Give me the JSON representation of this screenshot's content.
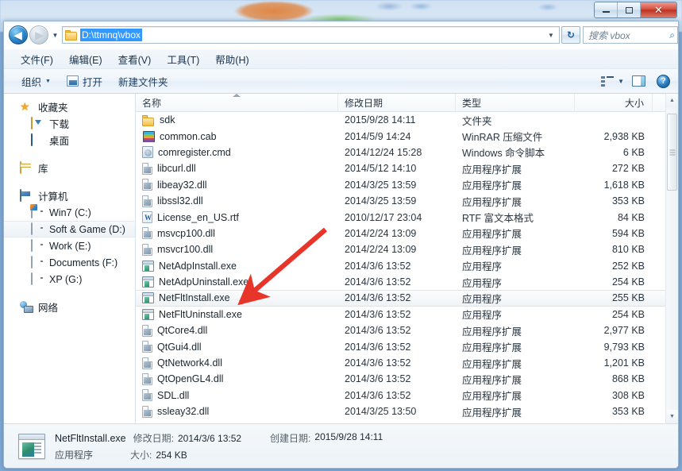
{
  "window": {
    "minimize_label": "–",
    "maximize_label": "□",
    "close_label": "✕"
  },
  "address": {
    "path": "D:\\ttmnq\\vbox",
    "back_glyph": "◀",
    "forward_glyph": "▶",
    "history_glyph": "▼",
    "dropdown_glyph": "▼",
    "refresh_glyph": "↻"
  },
  "search": {
    "placeholder": "搜索 vbox",
    "icon_glyph": "⌕"
  },
  "menu": {
    "items": [
      {
        "label": "文件(F)"
      },
      {
        "label": "编辑(E)"
      },
      {
        "label": "查看(V)"
      },
      {
        "label": "工具(T)"
      },
      {
        "label": "帮助(H)"
      }
    ]
  },
  "toolbar": {
    "organize_label": "组织",
    "organize_arrow": "▼",
    "open_label": "打开",
    "new_folder_label": "新建文件夹",
    "view_caret": "▼",
    "help_label": "?"
  },
  "sidebar": {
    "groups": [
      {
        "header": {
          "label": "收藏夹",
          "icon": "star-icon"
        },
        "items": [
          {
            "label": "下载",
            "icon": "downloads-icon"
          },
          {
            "label": "桌面",
            "icon": "desktop-icon"
          }
        ]
      },
      {
        "header": {
          "label": "库",
          "icon": "libraries-icon"
        },
        "items": []
      },
      {
        "header": {
          "label": "计算机",
          "icon": "computer-icon"
        },
        "items": [
          {
            "label": "Win7 (C:)",
            "icon": "system-drive-icon",
            "selected": false
          },
          {
            "label": "Soft & Game (D:)",
            "icon": "drive-icon",
            "selected": true
          },
          {
            "label": "Work (E:)",
            "icon": "drive-icon",
            "selected": false
          },
          {
            "label": "Documents (F:)",
            "icon": "drive-icon",
            "selected": false
          },
          {
            "label": "XP (G:)",
            "icon": "drive-icon",
            "selected": false
          }
        ]
      },
      {
        "header": {
          "label": "网络",
          "icon": "network-icon"
        },
        "items": []
      }
    ]
  },
  "filelist": {
    "columns": [
      {
        "label": "名称",
        "key": "name",
        "sorted": "asc"
      },
      {
        "label": "修改日期",
        "key": "date"
      },
      {
        "label": "类型",
        "key": "type"
      },
      {
        "label": "大小",
        "key": "size"
      }
    ],
    "rows": [
      {
        "name": "sdk",
        "date": "2015/9/28 14:11",
        "type": "文件夹",
        "size": "",
        "icon": "folder-icon",
        "selected": false
      },
      {
        "name": "common.cab",
        "date": "2014/5/9 14:24",
        "type": "WinRAR 压缩文件",
        "size": "2,938 KB",
        "icon": "winrar-archive-icon",
        "selected": false
      },
      {
        "name": "comregister.cmd",
        "date": "2014/12/24 15:28",
        "type": "Windows 命令脚本",
        "size": "6 KB",
        "icon": "cmd-script-icon",
        "selected": false
      },
      {
        "name": "libcurl.dll",
        "date": "2014/5/12 14:10",
        "type": "应用程序扩展",
        "size": "272 KB",
        "icon": "dll-icon",
        "selected": false
      },
      {
        "name": "libeay32.dll",
        "date": "2014/3/25 13:59",
        "type": "应用程序扩展",
        "size": "1,618 KB",
        "icon": "dll-icon",
        "selected": false
      },
      {
        "name": "libssl32.dll",
        "date": "2014/3/25 13:59",
        "type": "应用程序扩展",
        "size": "353 KB",
        "icon": "dll-icon",
        "selected": false
      },
      {
        "name": "License_en_US.rtf",
        "date": "2010/12/17 23:04",
        "type": "RTF 富文本格式",
        "size": "84 KB",
        "icon": "rtf-document-icon",
        "selected": false
      },
      {
        "name": "msvcp100.dll",
        "date": "2014/2/24 13:09",
        "type": "应用程序扩展",
        "size": "594 KB",
        "icon": "dll-icon",
        "selected": false
      },
      {
        "name": "msvcr100.dll",
        "date": "2014/2/24 13:09",
        "type": "应用程序扩展",
        "size": "810 KB",
        "icon": "dll-icon",
        "selected": false
      },
      {
        "name": "NetAdpInstall.exe",
        "date": "2014/3/6 13:52",
        "type": "应用程序",
        "size": "252 KB",
        "icon": "exe-icon",
        "selected": false
      },
      {
        "name": "NetAdpUninstall.exe",
        "date": "2014/3/6 13:52",
        "type": "应用程序",
        "size": "254 KB",
        "icon": "exe-icon",
        "selected": false
      },
      {
        "name": "NetFltInstall.exe",
        "date": "2014/3/6 13:52",
        "type": "应用程序",
        "size": "255 KB",
        "icon": "exe-icon",
        "selected": true
      },
      {
        "name": "NetFltUninstall.exe",
        "date": "2014/3/6 13:52",
        "type": "应用程序",
        "size": "254 KB",
        "icon": "exe-icon",
        "selected": false
      },
      {
        "name": "QtCore4.dll",
        "date": "2014/3/6 13:52",
        "type": "应用程序扩展",
        "size": "2,977 KB",
        "icon": "dll-icon",
        "selected": false
      },
      {
        "name": "QtGui4.dll",
        "date": "2014/3/6 13:52",
        "type": "应用程序扩展",
        "size": "9,793 KB",
        "icon": "dll-icon",
        "selected": false
      },
      {
        "name": "QtNetwork4.dll",
        "date": "2014/3/6 13:52",
        "type": "应用程序扩展",
        "size": "1,201 KB",
        "icon": "dll-icon",
        "selected": false
      },
      {
        "name": "QtOpenGL4.dll",
        "date": "2014/3/6 13:52",
        "type": "应用程序扩展",
        "size": "868 KB",
        "icon": "dll-icon",
        "selected": false
      },
      {
        "name": "SDL.dll",
        "date": "2014/3/6 13:52",
        "type": "应用程序扩展",
        "size": "308 KB",
        "icon": "dll-icon",
        "selected": false
      },
      {
        "name": "ssleay32.dll",
        "date": "2014/3/25 13:50",
        "type": "应用程序扩展",
        "size": "353 KB",
        "icon": "dll-icon",
        "selected": false
      }
    ],
    "scroll_up_glyph": "▲",
    "scroll_down_glyph": "▼"
  },
  "details": {
    "file_name": "NetFltInstall.exe",
    "modified_label": "修改日期:",
    "modified_value": "2014/3/6 13:52",
    "created_label": "创建日期:",
    "created_value": "2015/9/28 14:11",
    "file_type": "应用程序",
    "size_label": "大小:",
    "size_value": "254 KB"
  },
  "annotation": {
    "color": "#e8352a",
    "type": "arrow",
    "points_to": "NetFltInstall.exe"
  }
}
